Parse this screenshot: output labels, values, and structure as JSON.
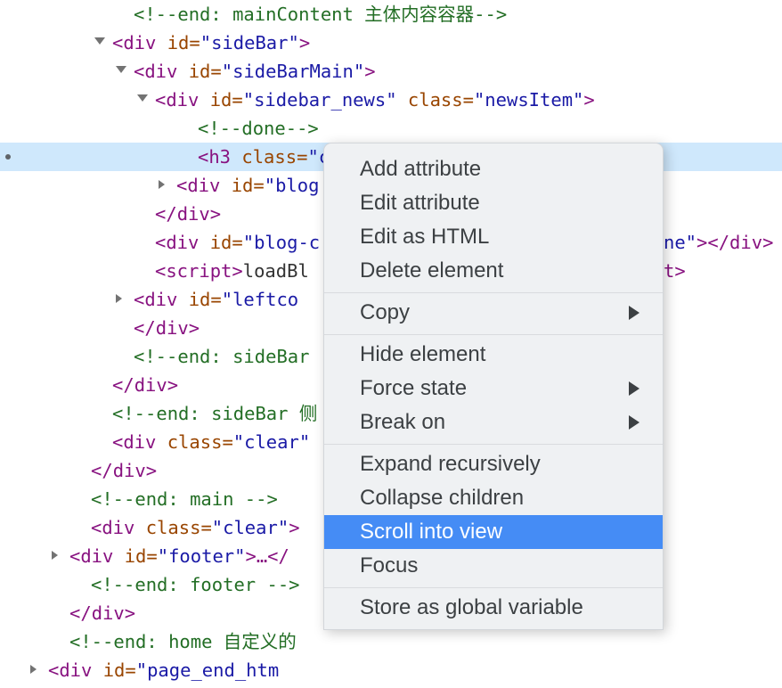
{
  "dom_tree": {
    "rows": [
      {
        "indent": 5,
        "twisty": "none",
        "selected": false,
        "tokens": [
          {
            "type": "comment",
            "text": "<!--end: mainContent 主体内容容器-->"
          }
        ]
      },
      {
        "indent": 4,
        "twisty": "open",
        "selected": false,
        "tokens": [
          {
            "type": "punct",
            "text": "<"
          },
          {
            "type": "tag",
            "text": "div"
          },
          {
            "type": "text",
            "text": " "
          },
          {
            "type": "attr",
            "text": "id"
          },
          {
            "type": "eq",
            "text": "="
          },
          {
            "type": "value",
            "text": "\"sideBar\""
          },
          {
            "type": "punct",
            "text": ">"
          }
        ]
      },
      {
        "indent": 5,
        "twisty": "open",
        "selected": false,
        "tokens": [
          {
            "type": "punct",
            "text": "<"
          },
          {
            "type": "tag",
            "text": "div"
          },
          {
            "type": "text",
            "text": " "
          },
          {
            "type": "attr",
            "text": "id"
          },
          {
            "type": "eq",
            "text": "="
          },
          {
            "type": "value",
            "text": "\"sideBarMain\""
          },
          {
            "type": "punct",
            "text": ">"
          }
        ]
      },
      {
        "indent": 6,
        "twisty": "open",
        "selected": false,
        "tokens": [
          {
            "type": "punct",
            "text": "<"
          },
          {
            "type": "tag",
            "text": "div"
          },
          {
            "type": "text",
            "text": " "
          },
          {
            "type": "attr",
            "text": "id"
          },
          {
            "type": "eq",
            "text": "="
          },
          {
            "type": "value",
            "text": "\"sidebar_news\""
          },
          {
            "type": "text",
            "text": " "
          },
          {
            "type": "attr",
            "text": "class"
          },
          {
            "type": "eq",
            "text": "="
          },
          {
            "type": "value",
            "text": "\"newsItem\""
          },
          {
            "type": "punct",
            "text": ">"
          }
        ]
      },
      {
        "indent": 8,
        "twisty": "none",
        "selected": false,
        "tokens": [
          {
            "type": "comment",
            "text": "<!--done-->"
          }
        ]
      },
      {
        "indent": 8,
        "twisty": "none",
        "selected": true,
        "tokens": [
          {
            "type": "punct",
            "text": "<"
          },
          {
            "type": "tag",
            "text": "h3"
          },
          {
            "type": "text",
            "text": " "
          },
          {
            "type": "attr",
            "text": "class"
          },
          {
            "type": "eq",
            "text": "="
          },
          {
            "type": "value",
            "text": "\"ca"
          }
        ]
      },
      {
        "indent": 7,
        "twisty": "closed",
        "selected": false,
        "tokens": [
          {
            "type": "punct",
            "text": "<"
          },
          {
            "type": "tag",
            "text": "div"
          },
          {
            "type": "text",
            "text": " "
          },
          {
            "type": "attr",
            "text": "id"
          },
          {
            "type": "eq",
            "text": "="
          },
          {
            "type": "value",
            "text": "\"blog"
          }
        ]
      },
      {
        "indent": 6,
        "twisty": "none",
        "selected": false,
        "tokens": [
          {
            "type": "punct",
            "text": "</"
          },
          {
            "type": "tag",
            "text": "div"
          },
          {
            "type": "punct",
            "text": ">"
          }
        ]
      },
      {
        "indent": 6,
        "twisty": "none",
        "selected": false,
        "tokens": [
          {
            "type": "punct",
            "text": "<"
          },
          {
            "type": "tag",
            "text": "div"
          },
          {
            "type": "text",
            "text": " "
          },
          {
            "type": "attr",
            "text": "id"
          },
          {
            "type": "eq",
            "text": "="
          },
          {
            "type": "value",
            "text": "\"blog-c"
          }
        ],
        "tail": [
          {
            "type": "value",
            "text": "ne\""
          },
          {
            "type": "punct",
            "text": "></div>"
          }
        ]
      },
      {
        "indent": 6,
        "twisty": "none",
        "selected": false,
        "tokens": [
          {
            "type": "punct",
            "text": "<"
          },
          {
            "type": "tag",
            "text": "script"
          },
          {
            "type": "punct",
            "text": ">"
          },
          {
            "type": "text",
            "text": "loadBl"
          }
        ],
        "tail": [
          {
            "type": "punct",
            "text": "t>"
          }
        ]
      },
      {
        "indent": 5,
        "twisty": "closed",
        "selected": false,
        "tokens": [
          {
            "type": "punct",
            "text": "<"
          },
          {
            "type": "tag",
            "text": "div"
          },
          {
            "type": "text",
            "text": " "
          },
          {
            "type": "attr",
            "text": "id"
          },
          {
            "type": "eq",
            "text": "="
          },
          {
            "type": "value",
            "text": "\"leftco"
          }
        ]
      },
      {
        "indent": 5,
        "twisty": "none",
        "selected": false,
        "tokens": [
          {
            "type": "punct",
            "text": "</"
          },
          {
            "type": "tag",
            "text": "div"
          },
          {
            "type": "punct",
            "text": ">"
          }
        ]
      },
      {
        "indent": 5,
        "twisty": "none",
        "selected": false,
        "tokens": [
          {
            "type": "comment",
            "text": "<!--end: sideBar"
          }
        ]
      },
      {
        "indent": 4,
        "twisty": "none",
        "selected": false,
        "tokens": [
          {
            "type": "punct",
            "text": "</"
          },
          {
            "type": "tag",
            "text": "div"
          },
          {
            "type": "punct",
            "text": ">"
          }
        ]
      },
      {
        "indent": 4,
        "twisty": "none",
        "selected": false,
        "tokens": [
          {
            "type": "comment",
            "text": "<!--end: sideBar 侧"
          }
        ]
      },
      {
        "indent": 4,
        "twisty": "none",
        "selected": false,
        "tokens": [
          {
            "type": "punct",
            "text": "<"
          },
          {
            "type": "tag",
            "text": "div"
          },
          {
            "type": "text",
            "text": " "
          },
          {
            "type": "attr",
            "text": "class"
          },
          {
            "type": "eq",
            "text": "="
          },
          {
            "type": "value",
            "text": "\"clear\""
          }
        ]
      },
      {
        "indent": 3,
        "twisty": "none",
        "selected": false,
        "tokens": [
          {
            "type": "punct",
            "text": "</"
          },
          {
            "type": "tag",
            "text": "div"
          },
          {
            "type": "punct",
            "text": ">"
          }
        ]
      },
      {
        "indent": 3,
        "twisty": "none",
        "selected": false,
        "tokens": [
          {
            "type": "comment",
            "text": "<!--end: main -->"
          }
        ]
      },
      {
        "indent": 3,
        "twisty": "none",
        "selected": false,
        "tokens": [
          {
            "type": "punct",
            "text": "<"
          },
          {
            "type": "tag",
            "text": "div"
          },
          {
            "type": "text",
            "text": " "
          },
          {
            "type": "attr",
            "text": "class"
          },
          {
            "type": "eq",
            "text": "="
          },
          {
            "type": "value",
            "text": "\"clear\""
          },
          {
            "type": "punct",
            "text": ">"
          }
        ]
      },
      {
        "indent": 2,
        "twisty": "closed",
        "selected": false,
        "tokens": [
          {
            "type": "punct",
            "text": "<"
          },
          {
            "type": "tag",
            "text": "div"
          },
          {
            "type": "text",
            "text": " "
          },
          {
            "type": "attr",
            "text": "id"
          },
          {
            "type": "eq",
            "text": "="
          },
          {
            "type": "value",
            "text": "\"footer\""
          },
          {
            "type": "punct",
            "text": ">…</"
          }
        ]
      },
      {
        "indent": 3,
        "twisty": "none",
        "selected": false,
        "tokens": [
          {
            "type": "comment",
            "text": "<!--end: footer -->"
          }
        ]
      },
      {
        "indent": 2,
        "twisty": "none",
        "selected": false,
        "tokens": [
          {
            "type": "punct",
            "text": "</"
          },
          {
            "type": "tag",
            "text": "div"
          },
          {
            "type": "punct",
            "text": ">"
          }
        ]
      },
      {
        "indent": 2,
        "twisty": "none",
        "selected": false,
        "tokens": [
          {
            "type": "comment",
            "text": "<!--end: home 自定义的"
          }
        ]
      },
      {
        "indent": 1,
        "twisty": "closed",
        "selected": false,
        "tokens": [
          {
            "type": "punct",
            "text": "<"
          },
          {
            "type": "tag",
            "text": "div"
          },
          {
            "type": "text",
            "text": " "
          },
          {
            "type": "attr",
            "text": "id"
          },
          {
            "type": "eq",
            "text": "="
          },
          {
            "type": "value",
            "text": "\"page_end_htm"
          }
        ]
      }
    ]
  },
  "context_menu": {
    "highlight_color": "#458cf5",
    "background_color": "#eff1f3",
    "text_color": "#3c4043",
    "groups": [
      {
        "items": [
          {
            "label": "Add attribute",
            "submenu": false,
            "highlighted": false
          },
          {
            "label": "Edit attribute",
            "submenu": false,
            "highlighted": false
          },
          {
            "label": "Edit as HTML",
            "submenu": false,
            "highlighted": false
          },
          {
            "label": "Delete element",
            "submenu": false,
            "highlighted": false
          }
        ]
      },
      {
        "items": [
          {
            "label": "Copy",
            "submenu": true,
            "highlighted": false
          }
        ]
      },
      {
        "items": [
          {
            "label": "Hide element",
            "submenu": false,
            "highlighted": false
          },
          {
            "label": "Force state",
            "submenu": true,
            "highlighted": false
          },
          {
            "label": "Break on",
            "submenu": true,
            "highlighted": false
          }
        ]
      },
      {
        "items": [
          {
            "label": "Expand recursively",
            "submenu": false,
            "highlighted": false
          },
          {
            "label": "Collapse children",
            "submenu": false,
            "highlighted": false
          },
          {
            "label": "Scroll into view",
            "submenu": false,
            "highlighted": true
          },
          {
            "label": "Focus",
            "submenu": false,
            "highlighted": false
          }
        ]
      },
      {
        "items": [
          {
            "label": "Store as global variable",
            "submenu": false,
            "highlighted": false
          }
        ]
      }
    ]
  }
}
